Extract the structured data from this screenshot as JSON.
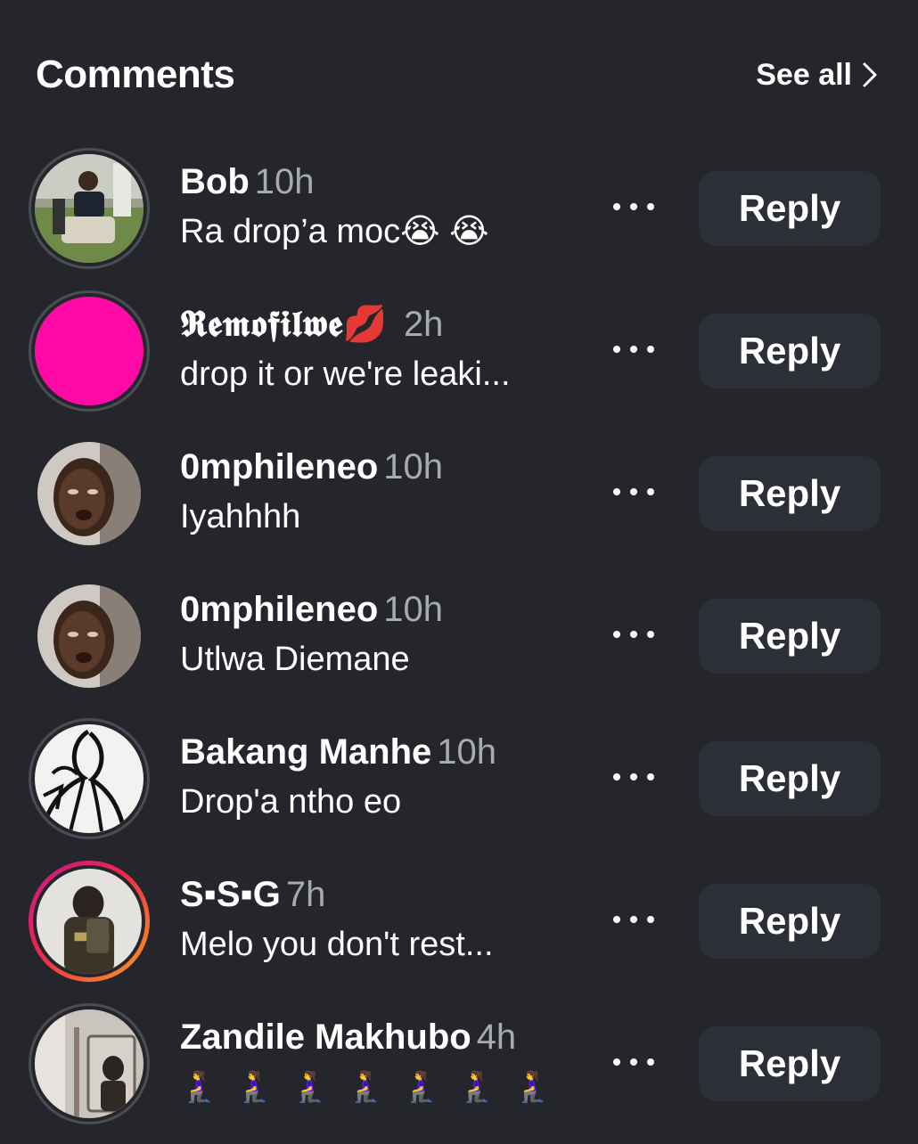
{
  "header": {
    "title": "Comments",
    "see_all": "See all"
  },
  "comments": [
    {
      "name": "Bob",
      "time": "10h",
      "text": "Ra drop’a moc😭 😭",
      "reply": "Reply",
      "avatar": "photo-person-sitting"
    },
    {
      "name": "𝕽𝖊𝖒𝖔𝖋𝖎𝖑𝖜𝖊💋",
      "time": "2h",
      "text": "drop it or we're leaki...",
      "reply": "Reply",
      "avatar": "solid-pink",
      "avatar_color": "#ff0aa6"
    },
    {
      "name": "0mphileneo",
      "time": "10h",
      "text": "Iyahhhh",
      "reply": "Reply",
      "avatar": "photo-face"
    },
    {
      "name": "0mphileneo",
      "time": "10h",
      "text": "Utlwa Diemane",
      "reply": "Reply",
      "avatar": "photo-face"
    },
    {
      "name": "Bakang Manhe",
      "time": "10h",
      "text": "Drop'a ntho eo",
      "reply": "Reply",
      "avatar": "sketch-art"
    },
    {
      "name": "S▪S▪G",
      "time": "7h",
      "text": "Melo you don't rest...",
      "reply": "Reply",
      "avatar": "photo-person-story"
    },
    {
      "name": "Zandile Makhubo",
      "time": "4h",
      "text": "🧎‍♀️🧎‍♀️🧎‍♀️🧎‍♀️🧎‍♀️🧎‍♀️🧎‍♀️",
      "reply": "Reply",
      "avatar": "photo-mirror"
    }
  ],
  "colors": {
    "background": "#24262b",
    "reply_bg": "#2c2f35",
    "muted": "#a7aab1",
    "story_ring": [
      "#c7168e",
      "#f0284a",
      "#f7a21e"
    ]
  }
}
